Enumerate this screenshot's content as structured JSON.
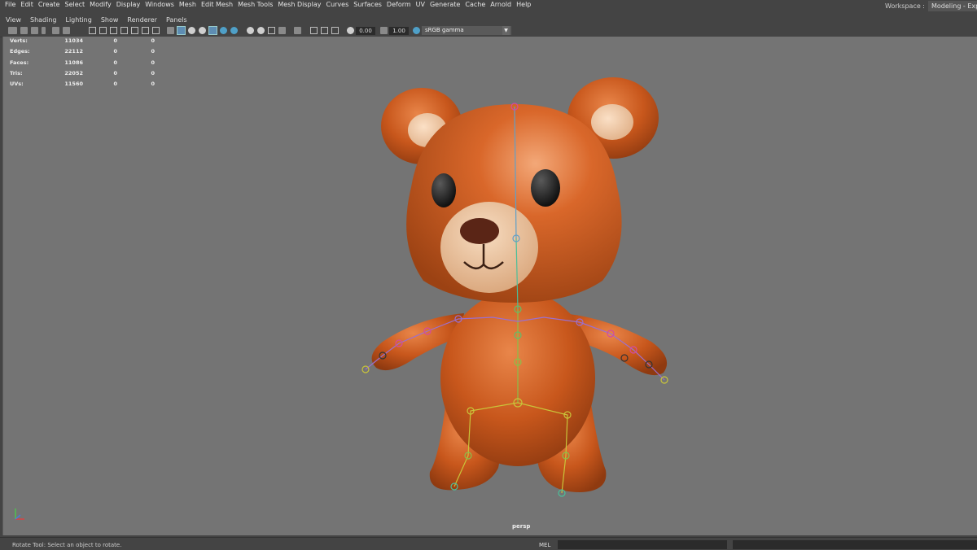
{
  "menubar": {
    "items": [
      "File",
      "Edit",
      "Create",
      "Select",
      "Modify",
      "Display",
      "Windows",
      "Mesh",
      "Edit Mesh",
      "Mesh Tools",
      "Mesh Display",
      "Curves",
      "Surfaces",
      "Deform",
      "UV",
      "Generate",
      "Cache",
      "Arnold",
      "Help"
    ],
    "workspace_label": "Workspace :",
    "workspace_value": "Modeling - Expe"
  },
  "panel_menu": {
    "items": [
      "View",
      "Shading",
      "Lighting",
      "Show",
      "Renderer",
      "Panels"
    ]
  },
  "toolbar": {
    "exposure": "0.00",
    "gamma": "1.00",
    "color_space": "sRGB gamma"
  },
  "hud": {
    "rows": [
      {
        "label": "Verts:",
        "v1": "11034",
        "v2": "0",
        "v3": "0"
      },
      {
        "label": "Edges:",
        "v1": "22112",
        "v2": "0",
        "v3": "0"
      },
      {
        "label": "Faces:",
        "v1": "11086",
        "v2": "0",
        "v3": "0"
      },
      {
        "label": "Tris:",
        "v1": "22052",
        "v2": "0",
        "v3": "0"
      },
      {
        "label": "UVs:",
        "v1": "11560",
        "v2": "0",
        "v3": "0"
      }
    ]
  },
  "viewport": {
    "camera_label": "persp",
    "model": "teddy-bear"
  },
  "statusbar": {
    "help_text": "Rotate Tool: Select an object to rotate.",
    "mel_label": "MEL"
  },
  "colors": {
    "viewport_bg": "#747474",
    "bear_body": "#c8571c",
    "bear_muzzle": "#efc49a",
    "joint_green": "#5fbf6a",
    "joint_magenta": "#d24aa0",
    "joint_yellow": "#c9c53a"
  }
}
